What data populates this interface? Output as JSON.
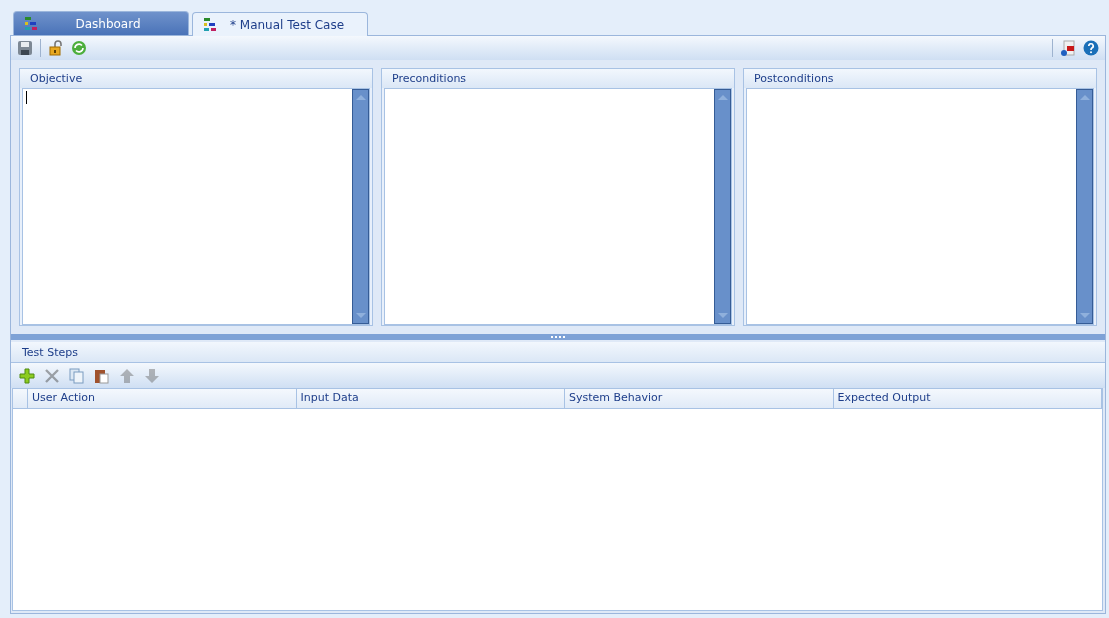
{
  "tabs": [
    {
      "label": "Dashboard",
      "selected": false
    },
    {
      "label": "* Manual Test Case",
      "selected": true
    }
  ],
  "toolbar": {
    "left_tools": [
      {
        "kind": "save"
      },
      {
        "kind": "unlock"
      },
      {
        "kind": "refresh"
      }
    ],
    "right_tools": [
      {
        "kind": "export"
      },
      {
        "kind": "help"
      }
    ]
  },
  "text_panels": [
    {
      "title": "Objective",
      "focused": true
    },
    {
      "title": "Preconditions",
      "focused": false
    },
    {
      "title": "Postconditions",
      "focused": false
    }
  ],
  "test_steps": {
    "title": "Test Steps",
    "tools": [
      {
        "kind": "add",
        "disabled": false
      },
      {
        "kind": "delete",
        "disabled": true
      },
      {
        "kind": "copy",
        "disabled": false
      },
      {
        "kind": "paste",
        "disabled": false
      },
      {
        "kind": "up",
        "disabled": true
      },
      {
        "kind": "down",
        "disabled": true
      }
    ],
    "columns": [
      "User Action",
      "Input Data",
      "System Behavior",
      "Expected Output"
    ]
  }
}
